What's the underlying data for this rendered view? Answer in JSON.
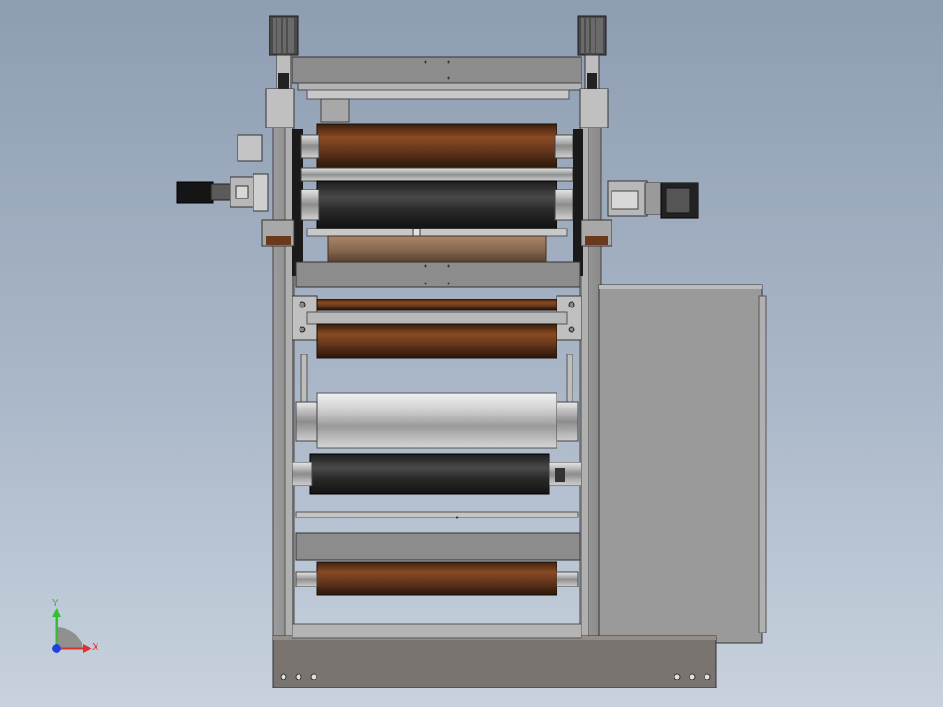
{
  "viewport": {
    "background_top": "#8e9db2",
    "background_bottom": "#c8d2de"
  },
  "model": {
    "frame_color": "#8a8a8a",
    "rollers": [
      {
        "name": "upper-brown-roller",
        "color": "#6b3a1e"
      },
      {
        "name": "black-rubber-roller",
        "color": "#2a2a2a"
      },
      {
        "name": "lower-tan-roller",
        "color": "#8a6a50"
      },
      {
        "name": "mid-brown-roller",
        "color": "#5e3a22"
      },
      {
        "name": "silver-chrome-roller",
        "color": "#b8b8b8"
      },
      {
        "name": "bottom-black-roller",
        "color": "#303030"
      },
      {
        "name": "bottom-brown-roller",
        "color": "#6a4228"
      }
    ],
    "control_cabinet_color": "#9a9a9a",
    "base_plate_color": "#7a7470"
  },
  "triad": {
    "x_label": "X",
    "y_label": "Y",
    "x_color": "#e03030",
    "y_color": "#30c030",
    "z_color": "#2040e0"
  }
}
